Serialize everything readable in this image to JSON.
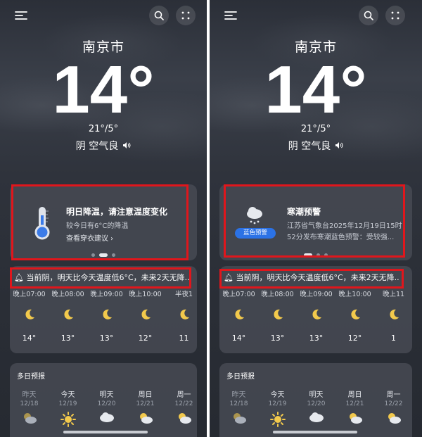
{
  "left": {
    "city": "南京市",
    "temp": "14°",
    "hilo": "21°/5°",
    "condition": "阴 空气良",
    "alert": {
      "title": "明日降温，请注意温度变化",
      "subtitle": "较今日有6°C的降温",
      "link": "查看穿衣建议 ›"
    },
    "banner": "当前阴，明天比今天温度低6°C，未来2天无降...",
    "hours": [
      {
        "time": "晚上07:00",
        "temp": "14°"
      },
      {
        "time": "晚上08:00",
        "temp": "13°"
      },
      {
        "time": "晚上09:00",
        "temp": "13°"
      },
      {
        "time": "晚上10:00",
        "temp": "12°"
      },
      {
        "time": "半夜1",
        "temp": "11"
      }
    ],
    "daily_title": "多日预报",
    "days": [
      {
        "name": "昨天",
        "date": "12/18"
      },
      {
        "name": "今天",
        "date": "12/19"
      },
      {
        "name": "明天",
        "date": "12/20"
      },
      {
        "name": "周日",
        "date": "12/21"
      },
      {
        "name": "周一",
        "date": "12/22"
      }
    ]
  },
  "right": {
    "city": "南京市",
    "temp": "14°",
    "hilo": "21°/5°",
    "condition": "阴 空气良",
    "warning": {
      "title": "寒潮预警",
      "badge": "蓝色预警",
      "text_line1": "江苏省气象台2025年12月19日15时",
      "text_line2": "52分发布寒潮蓝色预警：受较强..."
    },
    "banner": "当前阴，明天比今天温度低6°C，未来2天无降...",
    "hours": [
      {
        "time": "晚上07:00",
        "temp": "14°"
      },
      {
        "time": "晚上08:00",
        "temp": "13°"
      },
      {
        "time": "晚上09:00",
        "temp": "13°"
      },
      {
        "time": "晚上10:00",
        "temp": "12°"
      },
      {
        "time": "晚上11",
        "temp": "1"
      }
    ],
    "daily_title": "多日预报",
    "days": [
      {
        "name": "昨天",
        "date": "12/18"
      },
      {
        "name": "今天",
        "date": "12/19"
      },
      {
        "name": "明天",
        "date": "12/20"
      },
      {
        "name": "周日",
        "date": "12/21"
      },
      {
        "name": "周一",
        "date": "12/22"
      }
    ]
  },
  "colors": {
    "highlight": "#e0161c",
    "badge": "#2b72e6",
    "moon": "#f2c94c"
  }
}
